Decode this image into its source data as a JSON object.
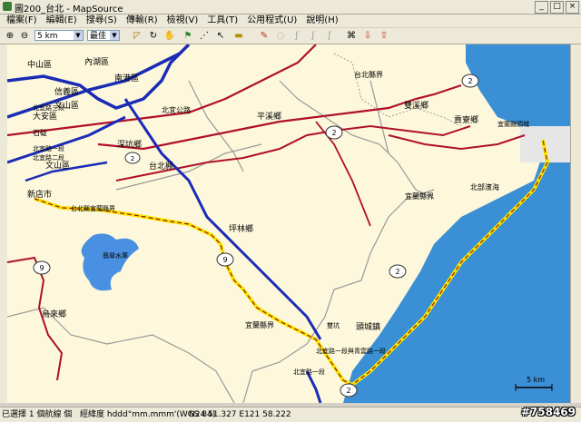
{
  "window": {
    "title": "圖200_台北 - MapSource",
    "min": "_",
    "max": "□",
    "close": "×"
  },
  "menu": [
    "檔案(F)",
    "編輯(E)",
    "搜尋(S)",
    "傳輸(R)",
    "檢視(V)",
    "工具(T)",
    "公用程式(U)",
    "說明(H)"
  ],
  "toolbar": {
    "zoom_scale": "5 km",
    "detail": "最佳"
  },
  "map": {
    "places": {
      "neihu": "內湖區",
      "zhongshan": "中山區",
      "nangang": "南港區",
      "xinyi": "信義區",
      "daan": "大安區",
      "wenshan1": "文山區",
      "wenshan2": "文山區",
      "xindian": "新店市",
      "taipei_county": "台北縣",
      "shenkeng": "深坑鄉",
      "pinglin": "坪林鄉",
      "pingxi": "平溪鄉",
      "shuangxi": "雙溪鄉",
      "gongliao": "貢寮鄉",
      "toucheng": "頭城鎮",
      "wulai": "烏來鄉",
      "feicui": "翡翠水庫",
      "yilan_border1": "宜蘭縣界",
      "yilan_border2": "宜蘭縣界",
      "beiyi_highway": "北宜公路",
      "taipei_border": "台北縣界",
      "coast_highway": "北部濱海",
      "hwy_label_1": "台北縣宜蘭縣界",
      "hwy_label_2": "北宜路一段",
      "hwy_label_3": "宜蘭縣頭城",
      "hwy_label_4": "北宜路二段",
      "hwy_label_5": "北宜路一段與青雲路一段",
      "hwy_label_6": "北宜路三段",
      "hwy_label_7": "北宜路一段",
      "shanmu": "石碇",
      "bridge": "雙坑"
    },
    "road_shields": [
      "2",
      "2",
      "2",
      "9",
      "9",
      "2",
      "2",
      "2"
    ],
    "scale_label": "5 km",
    "colors": {
      "sea": "#3b8fd4",
      "land": "#fdf8dc",
      "lake": "#4a90e2"
    }
  },
  "status": {
    "selection": "已選擇 1 個航線 個",
    "format_label": "經緯度 hddd°mm.mmm'(WGS 84)",
    "coords": "N24 51.327 E121 58.222"
  },
  "watermark": "#758469"
}
